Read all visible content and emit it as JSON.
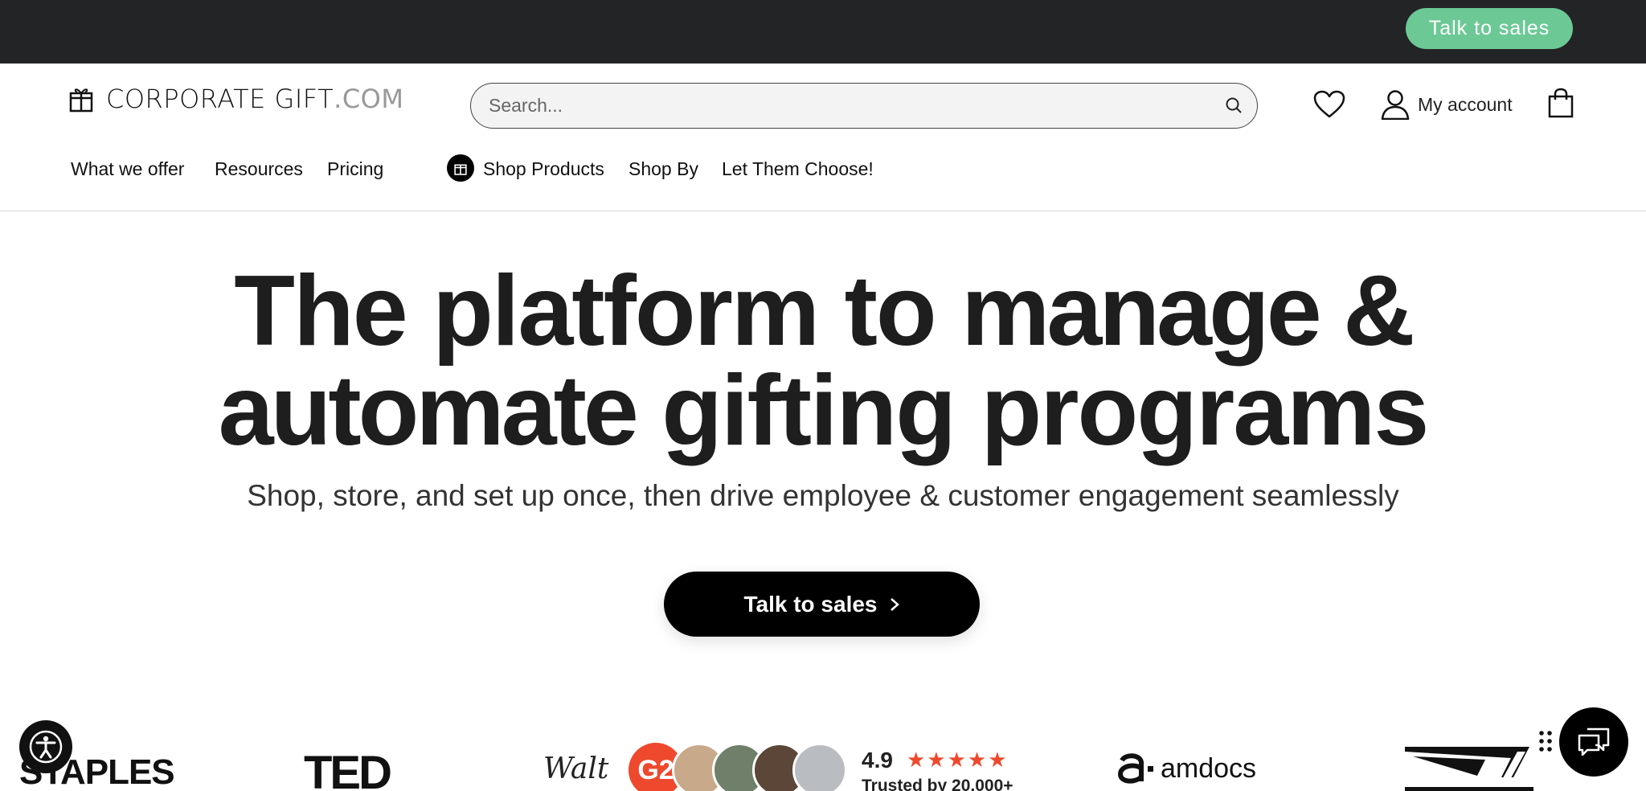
{
  "topbar": {
    "cta_label": "Talk to sales",
    "cta_color": "#6cc996",
    "background": "#232426"
  },
  "header": {
    "logo": {
      "name": "CORPORATE GIFT",
      "tld": ".COM",
      "icon": "gift-icon"
    },
    "search": {
      "placeholder": "Search...",
      "icon": "search-icon"
    },
    "wishlist_icon": "heart-icon",
    "account_label": "My account",
    "account_icon": "user-icon",
    "cart_icon": "shopping-bag-icon"
  },
  "nav": {
    "items": [
      {
        "label": "What we offer"
      },
      {
        "label": "Resources"
      },
      {
        "label": "Pricing"
      },
      {
        "label": "Shop Products",
        "icon": "gift-icon"
      },
      {
        "label": "Shop By"
      },
      {
        "label": "Let Them Choose!"
      }
    ]
  },
  "hero": {
    "title_part1": "The platform to ",
    "title_bold1": "manage &",
    "title_bold2": "automate",
    "title_part2": " gifting programs",
    "subtitle": "Shop, store, and set up once, then drive employee & customer engagement seamlessly",
    "cta_label": "Talk to sales",
    "cta_icon": "chevron-right-icon"
  },
  "logos": {
    "staples": "STAPLES",
    "ted": "TED",
    "walt": "Walt",
    "amdocs": "amdocs"
  },
  "review": {
    "badge": "G2",
    "rating": "4.9",
    "stars": "★★★★★",
    "trusted": "Trusted by 20,000+"
  },
  "widgets": {
    "accessibility_icon": "accessibility-icon",
    "chat_icon": "chat-icon"
  }
}
